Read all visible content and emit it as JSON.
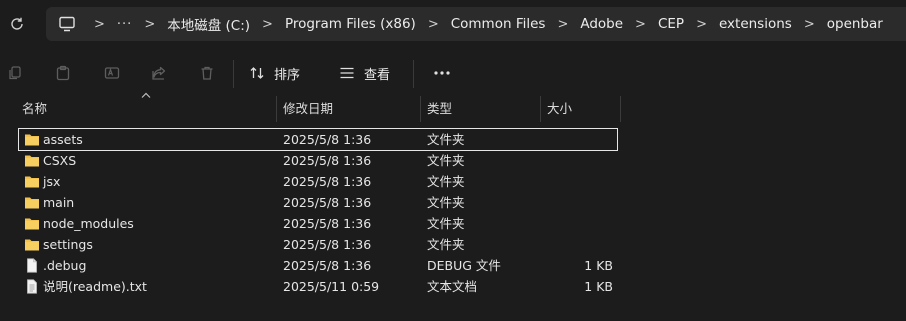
{
  "address": {
    "breadcrumbs": [
      "本地磁盘 (C:)",
      "Program Files (x86)",
      "Common Files",
      "Adobe",
      "CEP",
      "extensions",
      "openbar"
    ],
    "overflow": "···",
    "separator": ">"
  },
  "toolbar": {
    "sort_label": "排序",
    "view_label": "查看",
    "more": "···"
  },
  "columns": {
    "name": "名称",
    "modified": "修改日期",
    "type": "类型",
    "size": "大小"
  },
  "files": [
    {
      "name": "assets",
      "modified": "2025/5/8 1:36",
      "type": "文件夹",
      "size": "",
      "icon": "folder-icon"
    },
    {
      "name": "CSXS",
      "modified": "2025/5/8 1:36",
      "type": "文件夹",
      "size": "",
      "icon": "folder-icon"
    },
    {
      "name": "jsx",
      "modified": "2025/5/8 1:36",
      "type": "文件夹",
      "size": "",
      "icon": "folder-icon"
    },
    {
      "name": "main",
      "modified": "2025/5/8 1:36",
      "type": "文件夹",
      "size": "",
      "icon": "folder-icon"
    },
    {
      "name": "node_modules",
      "modified": "2025/5/8 1:36",
      "type": "文件夹",
      "size": "",
      "icon": "folder-icon"
    },
    {
      "name": "settings",
      "modified": "2025/5/8 1:36",
      "type": "文件夹",
      "size": "",
      "icon": "folder-icon"
    },
    {
      "name": ".debug",
      "modified": "2025/5/8 1:36",
      "type": "DEBUG 文件",
      "size": "1 KB",
      "icon": "file-icon"
    },
    {
      "name": "说明(readme).txt",
      "modified": "2025/5/11 0:59",
      "type": "文本文档",
      "size": "1 KB",
      "icon": "text-file-icon"
    }
  ],
  "colors": {
    "background": "#1c1c1c",
    "address_bar": "#2b2b2b",
    "folder": "#f2c14e",
    "selection_outline": "#e6e6e6"
  }
}
